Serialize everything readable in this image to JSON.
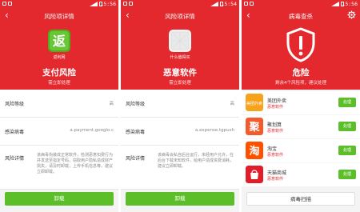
{
  "status_bar": {
    "time_1": "15:56",
    "time_2": "15:54",
    "time_3": "15:56"
  },
  "colors": {
    "header_red": "#e3292d",
    "button_green": "#5cbf2a"
  },
  "panel1": {
    "title": "风险项详情",
    "app_name": "返利网",
    "app_icon_char": "返",
    "risk_title": "支付风险",
    "risk_sub": "需立即处理",
    "rows": [
      {
        "label": "风险等级",
        "value": "高"
      },
      {
        "label": "感染病毒",
        "value": "a.payment.googlo.c"
      },
      {
        "label": "风险详情",
        "value": "该病毒伪装成正常软件，检测恶意扣费行为并发送至指定号码，窃取用户隐私造成财产损失，请及时卸载，上传手机信息等，建议立即卸载。"
      }
    ],
    "button": "卸载"
  },
  "panel2": {
    "title": "风险项详情",
    "app_name": "什么值得买",
    "risk_title": "恶意软件",
    "risk_sub": "需立即处理",
    "rows": [
      {
        "label": "风险等级",
        "value": "高"
      },
      {
        "label": "感染病毒",
        "value": "a.expense.tgpush"
      },
      {
        "label": "风险详情",
        "value": "该病毒会私自后台运行，未经用户允许，在后台下载未知软件，给用户造成资费消耗，建议立即卸载。"
      }
    ],
    "button": "卸载"
  },
  "panel3": {
    "title": "病毒查杀",
    "risk_title": "危险",
    "risk_sub": "剩余4个风险项，建议处理",
    "items": [
      {
        "name": "美团外卖",
        "sub": "恶意软件",
        "action": "处理",
        "icon_char": "美团外卖",
        "icon_color": "#f7a21b"
      },
      {
        "name": "聚划算",
        "sub": "恶意软件",
        "action": "处理",
        "icon_char": "聚",
        "icon_color": "#f35a2c"
      },
      {
        "name": "淘宝",
        "sub": "恶意软件",
        "action": "处理",
        "icon_char": "淘",
        "icon_color": "#ff5000"
      },
      {
        "name": "天猫商城",
        "sub": "恶意软件",
        "action": "处理",
        "icon_char": "",
        "icon_color": "#e11d2a"
      }
    ],
    "button": "病毒扫描"
  }
}
